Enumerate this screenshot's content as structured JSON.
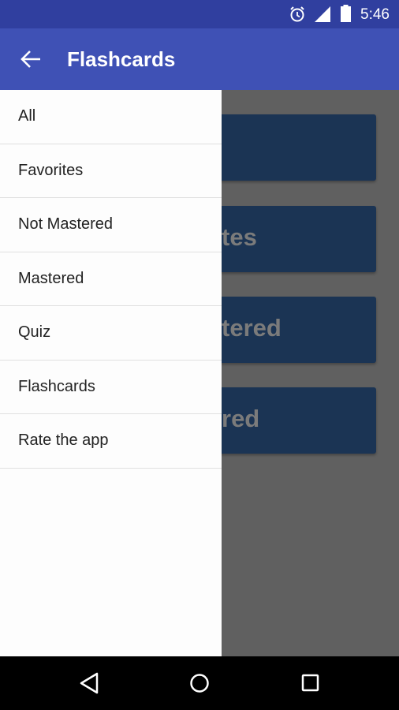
{
  "status_bar": {
    "time": "5:46",
    "icons": [
      "alarm-icon",
      "signal-icon",
      "battery-icon"
    ]
  },
  "app_bar": {
    "title": "Flashcards",
    "nav_icon": "arrow-back-icon"
  },
  "drawer": {
    "items": [
      {
        "label": "All"
      },
      {
        "label": "Favorites"
      },
      {
        "label": "Not Mastered"
      },
      {
        "label": "Mastered"
      },
      {
        "label": "Quiz"
      },
      {
        "label": "Flashcards"
      },
      {
        "label": "Rate the app"
      }
    ]
  },
  "background_cards": [
    {
      "label": ""
    },
    {
      "label": "tes"
    },
    {
      "label": "tered"
    },
    {
      "label": "red"
    }
  ],
  "colors": {
    "status_bar": "#303f9f",
    "app_bar": "#3f51b5",
    "card": "#1b3454",
    "scrim": "#606060"
  },
  "nav_bar": {
    "icons": [
      "back-triangle-icon",
      "home-circle-icon",
      "recents-square-icon"
    ]
  }
}
